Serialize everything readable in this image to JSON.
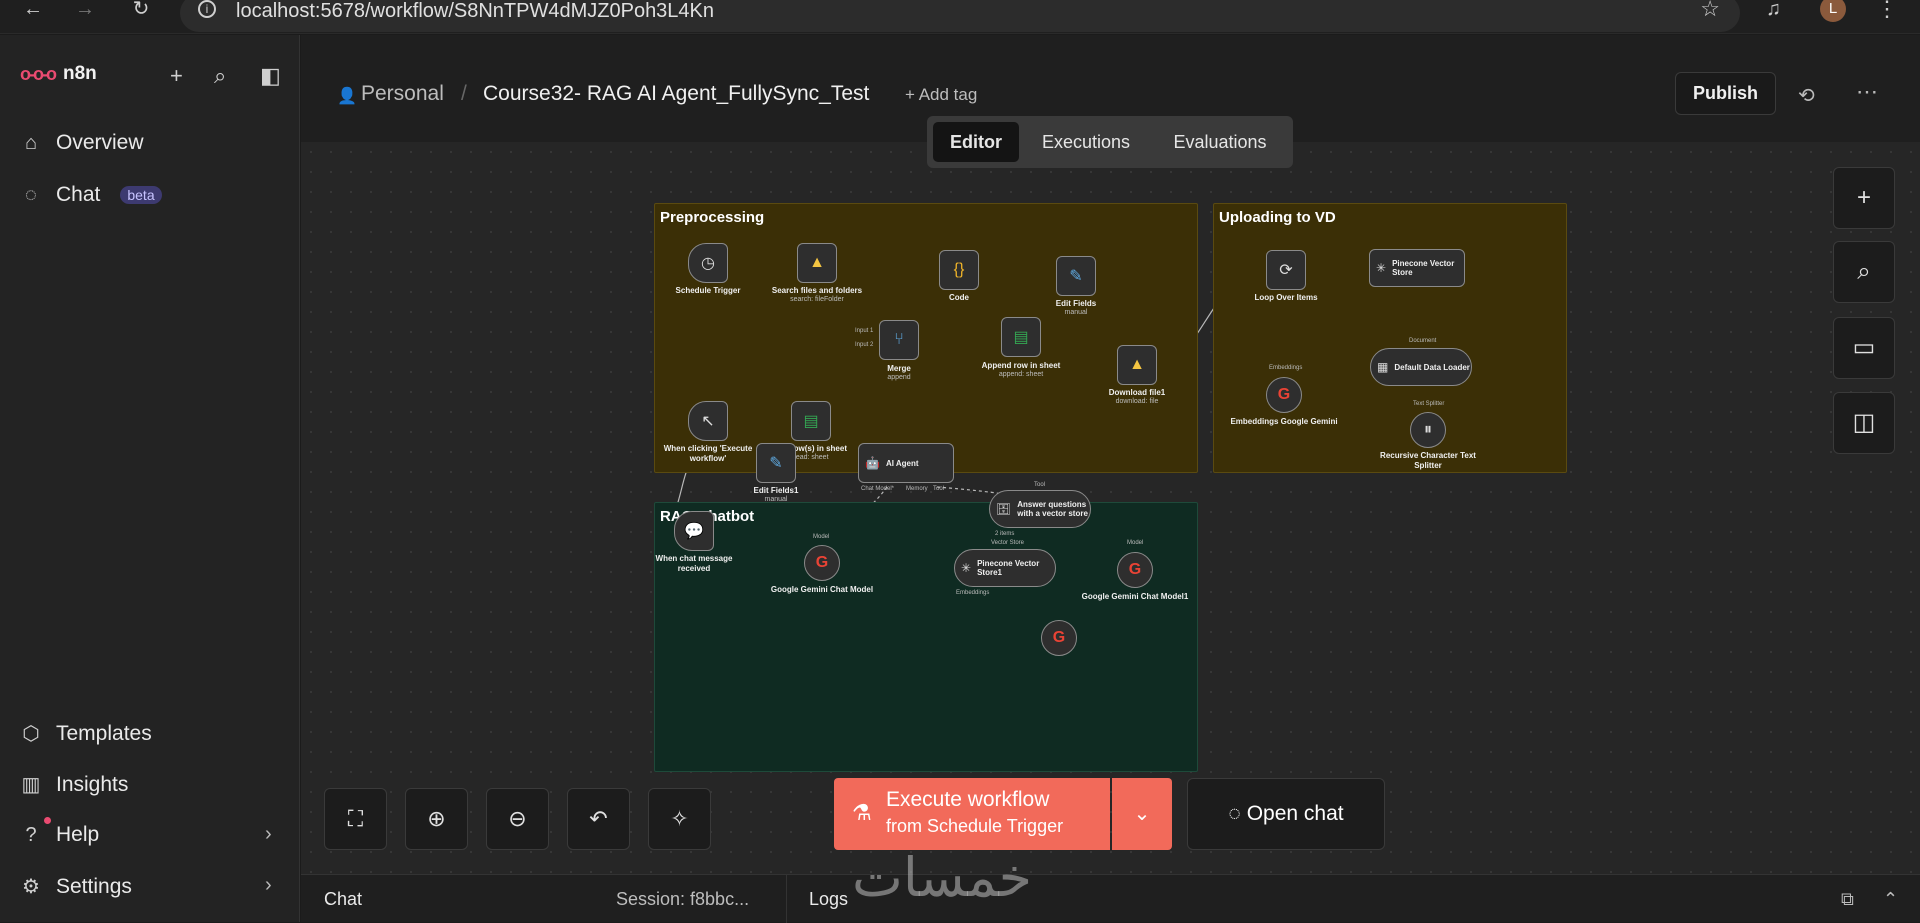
{
  "browser": {
    "url": "localhost:5678/workflow/S8NnTPW4dMJZ0Poh3L4Kn",
    "avatar_letter": "L"
  },
  "sidebar": {
    "brand": "n8n",
    "items": [
      {
        "label": "Overview",
        "icon": "home-icon"
      },
      {
        "label": "Chat",
        "icon": "chat-icon",
        "badge": "beta"
      }
    ],
    "bottom_items": [
      {
        "label": "Templates",
        "icon": "templates-icon"
      },
      {
        "label": "Insights",
        "icon": "insights-icon"
      },
      {
        "label": "Help",
        "icon": "help-icon"
      },
      {
        "label": "Settings",
        "icon": "settings-icon"
      }
    ]
  },
  "header": {
    "project": "Personal",
    "separator": "/",
    "workflow_name": "Course32- RAG AI Agent_FullySync_Test",
    "add_tag": "+ Add tag",
    "publish": "Publish",
    "tabs": [
      "Editor",
      "Executions",
      "Evaluations"
    ],
    "active_tab": "Editor"
  },
  "canvas": {
    "sticky_notes": [
      {
        "title": "Preprocessing",
        "color": "#3b2f06"
      },
      {
        "title": "Uploading to VD",
        "color": "#3b2f06"
      },
      {
        "title": "RAG Chatbot",
        "color": "#0f2b22"
      }
    ],
    "nodes": {
      "schedule_trigger": {
        "label": "Schedule Trigger"
      },
      "manual_trigger": {
        "label": "When clicking 'Execute workflow'"
      },
      "search_files": {
        "label": "Search files and folders",
        "sub": "search: fileFolder"
      },
      "get_rows": {
        "label": "Get row(s) in sheet",
        "sub": "read: sheet"
      },
      "merge": {
        "label": "Merge",
        "sub": "append",
        "port1": "Input 1",
        "port2": "Input 2"
      },
      "code": {
        "label": "Code"
      },
      "append_row": {
        "label": "Append row in sheet",
        "sub": "append: sheet"
      },
      "edit_fields": {
        "label": "Edit Fields",
        "sub": "manual"
      },
      "download_file": {
        "label": "Download file1",
        "sub": "download: file"
      },
      "loop_items": {
        "label": "Loop Over Items"
      },
      "pinecone_store": {
        "label": "Pinecone Vector Store"
      },
      "embeddings_gemini": {
        "label": "Embeddings Google Gemini",
        "port": "Embeddings"
      },
      "data_loader": {
        "label": "Default Data Loader",
        "port": "Document"
      },
      "text_splitter": {
        "label": "Recursive Character Text Splitter",
        "port": "Text Splitter"
      },
      "chat_trigger": {
        "label": "When chat message received"
      },
      "edit_fields1": {
        "label": "Edit Fields1",
        "sub": "manual"
      },
      "ai_agent": {
        "label": "AI Agent",
        "port_model": "Chat Model*",
        "port_memory": "Memory",
        "port_tool": "Tool"
      },
      "gemini_chat": {
        "label": "Google Gemini Chat Model",
        "port": "Model"
      },
      "answer_questions": {
        "label": "Answer questions with a vector store",
        "port": "Tool"
      },
      "pinecone_store1": {
        "label": "Pinecone Vector Store1",
        "port": "Vector Store",
        "items": "2 items"
      },
      "gemini_chat1": {
        "label": "Google Gemini Chat Model1",
        "port": "Model"
      },
      "embeddings_port": "Embeddings"
    }
  },
  "controls": {
    "execute_line1": "Execute workflow",
    "execute_line2": "from Schedule Trigger",
    "open_chat": "Open chat"
  },
  "bottom_panel": {
    "chat": "Chat",
    "session": "Session: f8bbc...",
    "logs": "Logs"
  },
  "watermark": "خمسات"
}
